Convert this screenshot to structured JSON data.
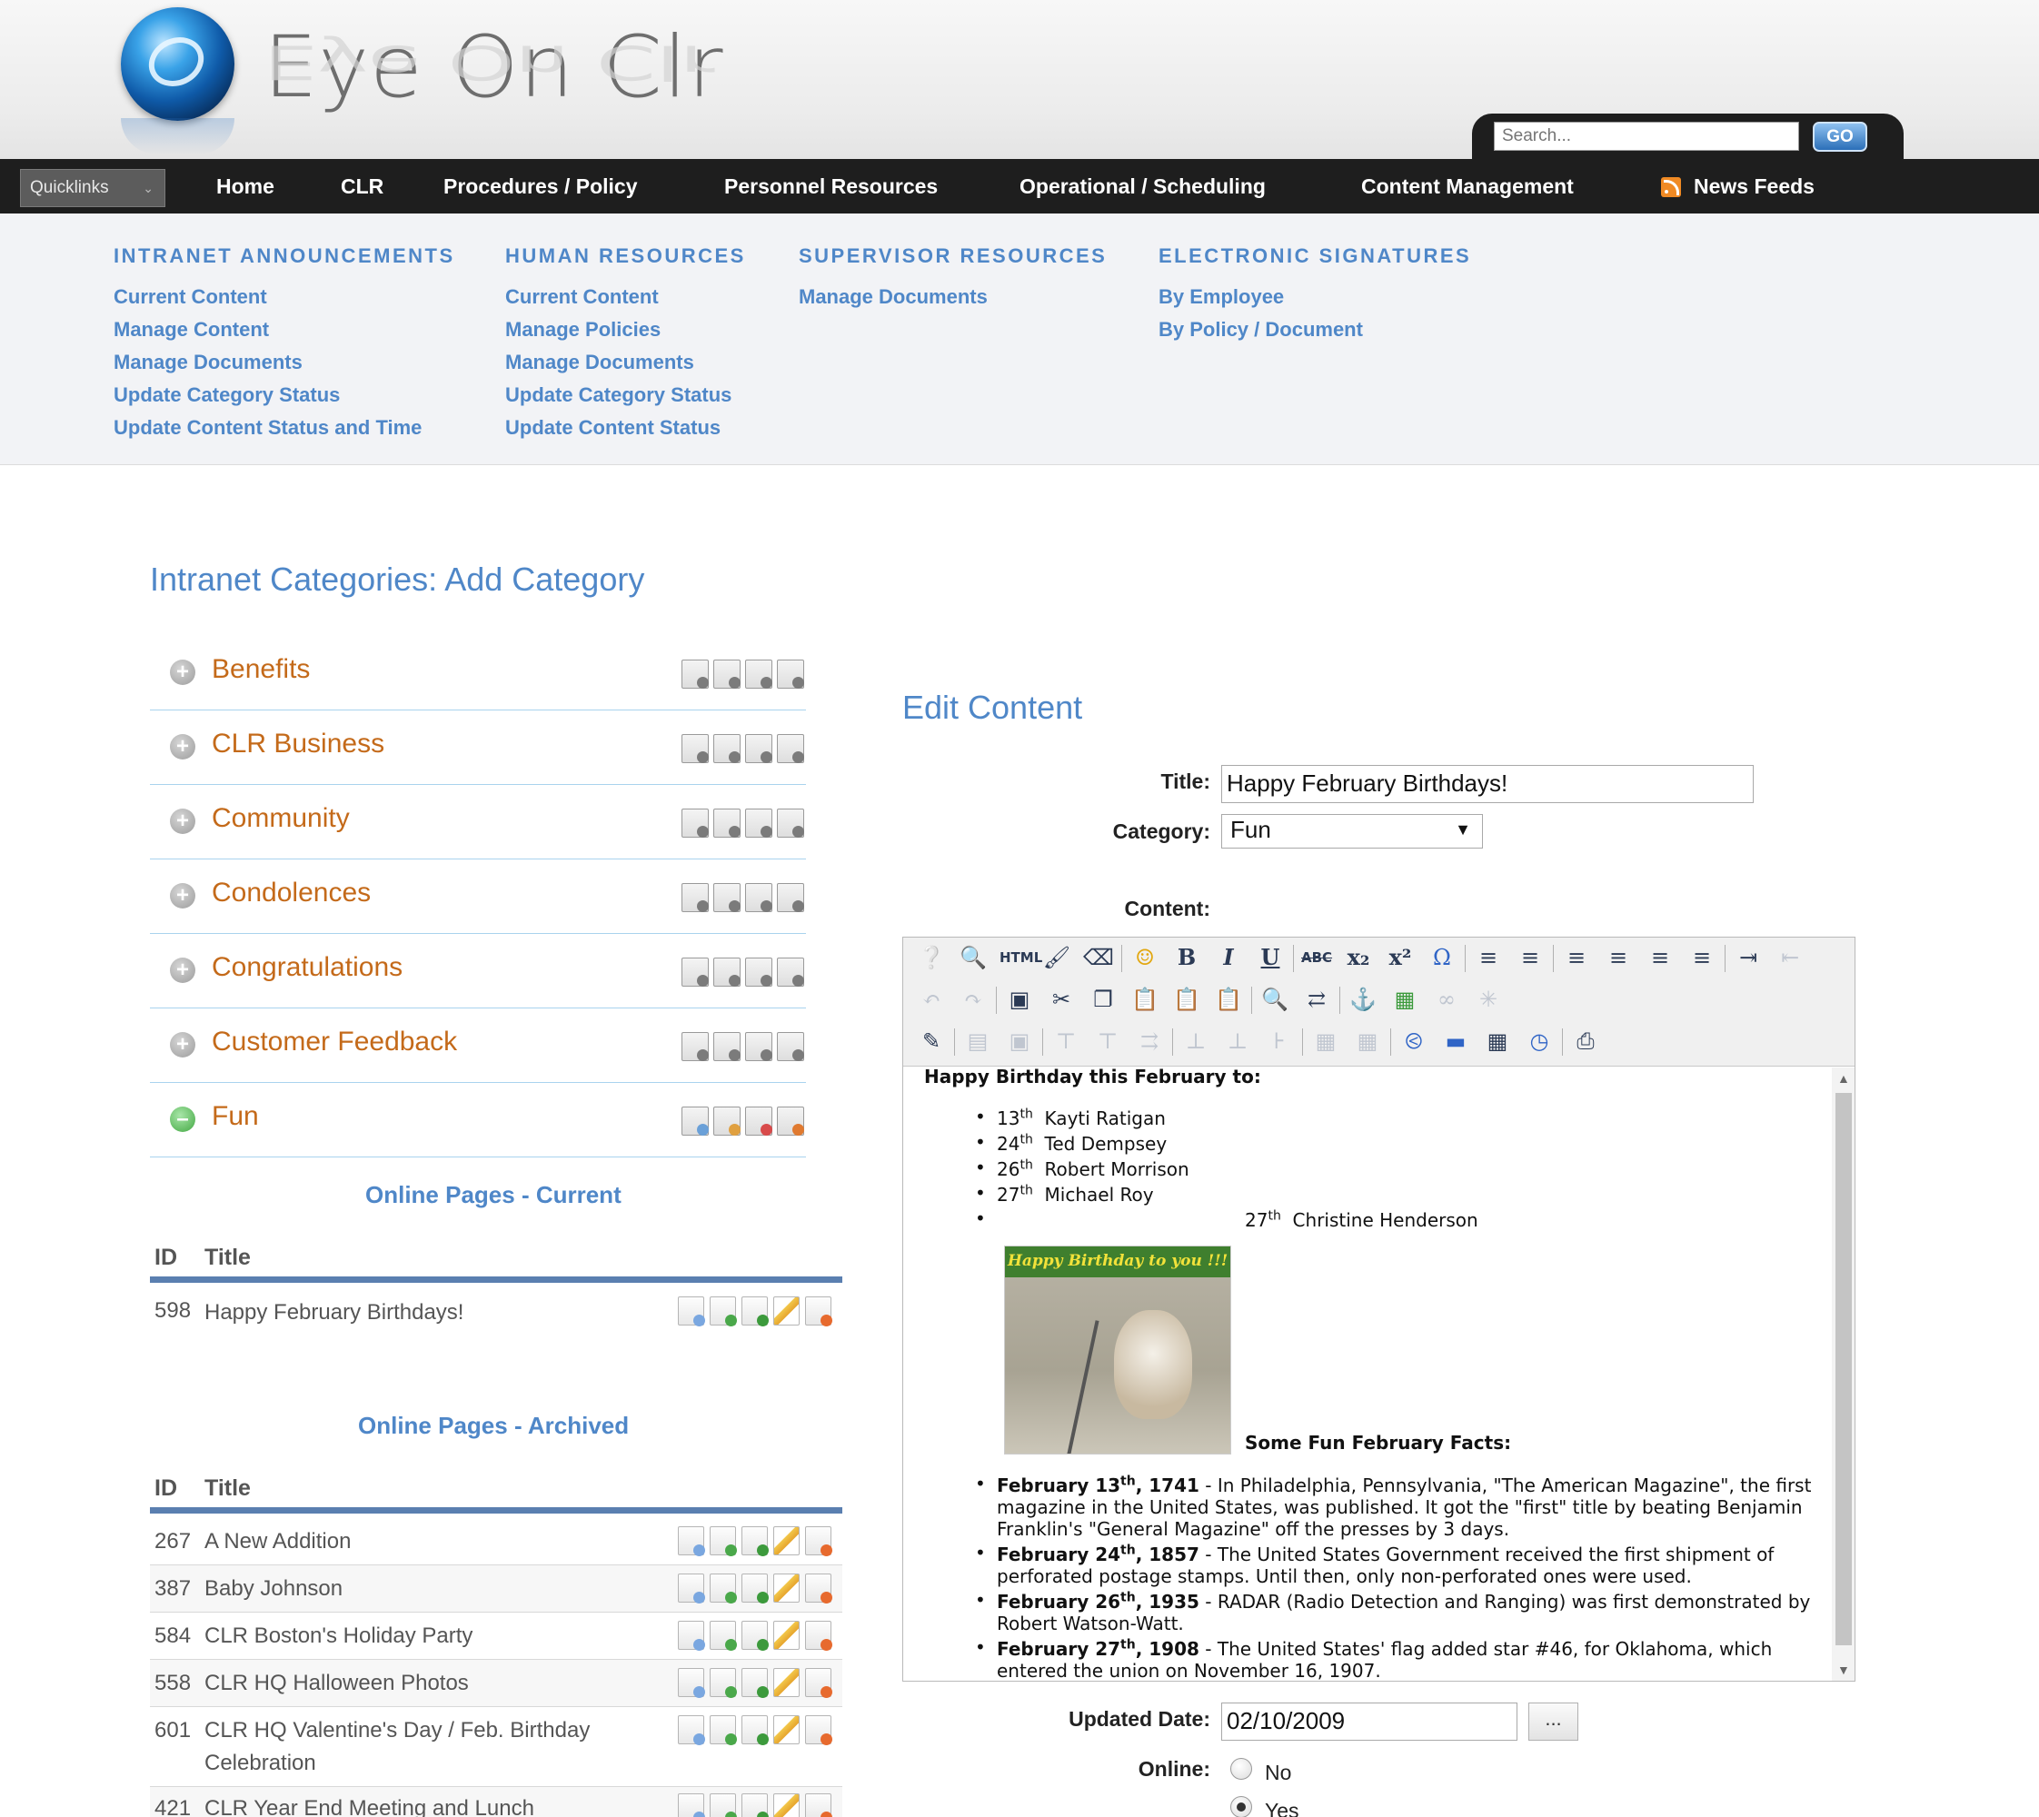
{
  "header": {
    "logo_text": "Eye On Clr",
    "search_placeholder": "Search...",
    "search_button": "GO"
  },
  "nav": {
    "quicklinks": "Quicklinks",
    "items": [
      "Home",
      "CLR",
      "Procedures / Policy",
      "Personnel Resources",
      "Operational / Scheduling",
      "Content Management",
      "News Feeds"
    ]
  },
  "dropdown": {
    "columns": [
      {
        "heading": "INTRANET ANNOUNCEMENTS",
        "links": [
          "Current Content",
          "Manage Content",
          "Manage Documents",
          "Update Category Status",
          "Update Content Status and Time"
        ]
      },
      {
        "heading": "HUMAN RESOURCES",
        "links": [
          "Current Content",
          "Manage Policies",
          "Manage Documents",
          "Update Category Status",
          "Update Content Status"
        ]
      },
      {
        "heading": "SUPERVISOR RESOURCES",
        "links": [
          "Manage Documents"
        ]
      },
      {
        "heading": "ELECTRONIC SIGNATURES",
        "links": [
          "By Employee",
          "By Policy / Document"
        ]
      }
    ]
  },
  "page_title": "Intranet Categories: Add Category",
  "categories": [
    "Benefits",
    "CLR Business",
    "Community",
    "Condolences",
    "Congratulations",
    "Customer Feedback",
    "Fun"
  ],
  "online_current": {
    "heading": "Online Pages - Current",
    "col_id": "ID",
    "col_title": "Title",
    "rows": [
      {
        "id": "598",
        "title": "Happy February Birthdays!"
      }
    ]
  },
  "online_archived": {
    "heading": "Online Pages - Archived",
    "col_id": "ID",
    "col_title": "Title",
    "rows": [
      {
        "id": "267",
        "title": "A New Addition"
      },
      {
        "id": "387",
        "title": "Baby Johnson"
      },
      {
        "id": "584",
        "title": "CLR Boston's Holiday Party"
      },
      {
        "id": "558",
        "title": "CLR HQ Halloween Photos"
      },
      {
        "id": "601",
        "title": "CLR HQ Valentine's Day / Feb. Birthday Celebration"
      },
      {
        "id": "421",
        "title": "CLR Year End Meeting and Lunch"
      }
    ]
  },
  "edit": {
    "heading": "Edit Content",
    "title_label": "Title:",
    "title_value": "Happy February Birthdays!",
    "category_label": "Category:",
    "category_value": "Fun",
    "content_label": "Content:",
    "updated_label": "Updated Date:",
    "updated_value": "02/10/2009",
    "date_button": "...",
    "online_label": "Online:",
    "online_options": [
      "No",
      "Yes"
    ],
    "online_selected": "Yes"
  },
  "editor_content": {
    "intro": "Happy Birthday this February to:",
    "birthdays": [
      {
        "day": "13",
        "suffix": "th",
        "name": "Kayti Ratigan"
      },
      {
        "day": "24",
        "suffix": "th",
        "name": "Ted Dempsey"
      },
      {
        "day": "26",
        "suffix": "th",
        "name": "Robert Morrison"
      },
      {
        "day": "27",
        "suffix": "th",
        "name": "Michael Roy"
      },
      {
        "day": "27",
        "suffix": "th",
        "name": "Christine Henderson"
      }
    ],
    "image_caption": "Happy Birthday to you !!!",
    "facts_heading": "Some Fun February Facts:",
    "facts": [
      {
        "date_pre": "February 13",
        "sup": "th",
        "year": ", 1741",
        "text": " - In Philadelphia, Pennsylvania, \"The American Magazine\", the first magazine in the United States, was published. It got the \"first\" title by beating Benjamin Franklin's \"General Magazine\" off the presses by 3 days."
      },
      {
        "date_pre": "February 24",
        "sup": "th",
        "year": ", 1857",
        "text": " - The United States Government received the first shipment of perforated postage stamps. Until then, only non-perforated ones were used."
      },
      {
        "date_pre": "February 26",
        "sup": "th",
        "year": ", 1935",
        "text": " - RADAR (Radio Detection and Ranging) was first demonstrated by Robert Watson-Watt."
      },
      {
        "date_pre": "February 27",
        "sup": "th",
        "year": ", 1908",
        "text": " - The United States' flag added star #46, for Oklahoma, which entered the union on November 16, 1907."
      }
    ]
  },
  "toolbar": {
    "html_label": "HTML",
    "abc_label": "ABC"
  },
  "colors": {
    "accent_blue": "#4f87c8",
    "category_orange": "#c46a1a",
    "nav_bg": "#1e1e1e",
    "dropdown_bg": "#f2f3f6"
  }
}
